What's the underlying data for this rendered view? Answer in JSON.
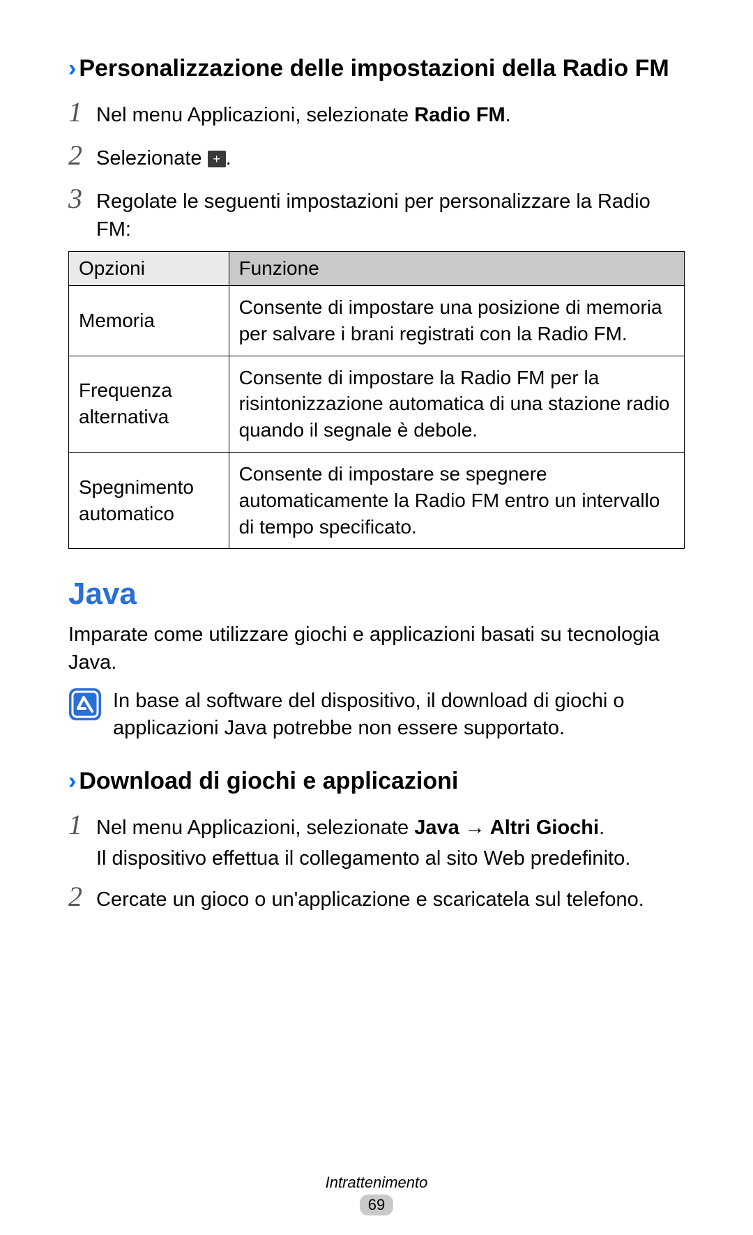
{
  "section1": {
    "title": "Personalizzazione delle impostazioni della Radio FM",
    "steps": {
      "1": {
        "prefix": "Nel menu Applicazioni, selezionate ",
        "bold": "Radio FM",
        "suffix": "."
      },
      "2": {
        "prefix": "Selezionate ",
        "suffix": "."
      },
      "3": "Regolate le seguenti impostazioni per personalizzare la Radio FM:"
    },
    "table": {
      "headers": {
        "opt": "Opzioni",
        "func": "Funzione"
      },
      "rows": [
        {
          "opt": "Memoria",
          "func": "Consente di impostare una posizione di memoria per salvare i brani registrati con la Radio FM."
        },
        {
          "opt": "Frequenza alternativa",
          "func": "Consente di impostare la Radio FM per la risintonizzazione automatica di una stazione radio quando il segnale è debole."
        },
        {
          "opt": "Spegnimento automatico",
          "func": "Consente di impostare se spegnere automaticamente la Radio FM entro un intervallo di tempo specificato."
        }
      ]
    }
  },
  "java": {
    "heading": "Java",
    "intro": "Imparate come utilizzare giochi e applicazioni basati su tecnologia Java.",
    "note": "In base al software del dispositivo, il download di giochi o applicazioni Java potrebbe non essere supportato."
  },
  "section2": {
    "title": "Download di giochi e applicazioni",
    "steps": {
      "1": {
        "prefix": "Nel menu Applicazioni, selezionate ",
        "bold": "Java → Altri Giochi",
        "suffix": ".",
        "sub": "Il dispositivo effettua il collegamento al sito Web predefinito."
      },
      "2": "Cercate un gioco o un'applicazione e scaricatela sul telefono."
    }
  },
  "footer": {
    "category": "Intrattenimento",
    "page": "69"
  },
  "icons": {
    "plus": "+"
  }
}
